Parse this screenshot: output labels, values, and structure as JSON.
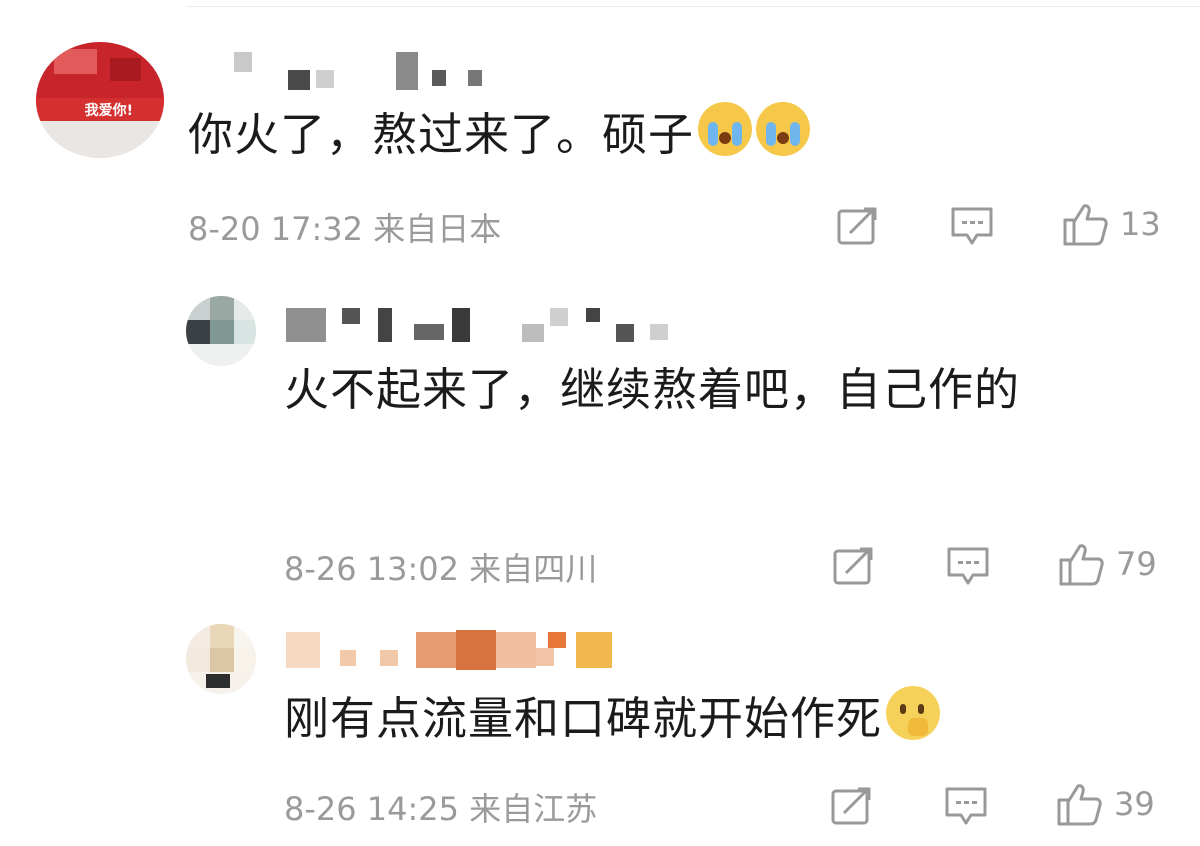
{
  "colors": {
    "text": "#1b1b1b",
    "meta": "#9a9a9a",
    "background": "#ffffff"
  },
  "comments": [
    {
      "avatar_text": "我爱你!",
      "text": "你火了，熬过来了。硕子",
      "emoji": [
        "loudly-crying-face",
        "loudly-crying-face"
      ],
      "date": "8-20 17:32",
      "location": "来自日本",
      "likes": "13"
    },
    {
      "text": "火不起来了，继续熬着吧，自己作的",
      "date": "8-26 13:02",
      "location": "来自四川",
      "likes": "79"
    },
    {
      "text": "刚有点流量和口碑就开始作死",
      "emoji": [
        "thinking-face"
      ],
      "date": "8-26 14:25",
      "location": "来自江苏",
      "likes": "39"
    }
  ],
  "icons": {
    "share": "share-icon",
    "reply": "comment-icon",
    "like": "thumbs-up-icon"
  }
}
